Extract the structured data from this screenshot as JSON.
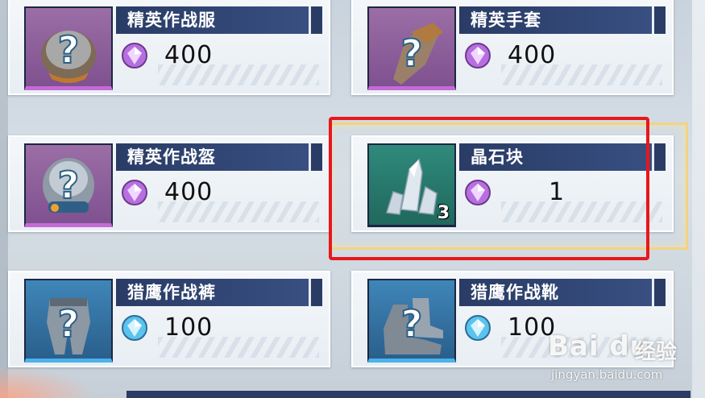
{
  "shop": {
    "items": [
      {
        "name": "精英作战服",
        "price": "400",
        "currency": "purple-gem",
        "rarity_color": "#9b6ea6"
      },
      {
        "name": "精英手套",
        "price": "400",
        "currency": "purple-gem",
        "rarity_color": "#9b6ea6"
      },
      {
        "name": "精英作战盔",
        "price": "400",
        "currency": "purple-gem",
        "rarity_color": "#9b6ea6"
      },
      {
        "name": "晶石块",
        "price": "1",
        "currency": "purple-gem",
        "stack": "3",
        "rarity_color": "#2f8a7c",
        "selected": true
      },
      {
        "name": "猎鹰作战裤",
        "price": "100",
        "currency": "blue-gem",
        "rarity_color": "#3f86b8"
      },
      {
        "name": "猎鹰作战靴",
        "price": "100",
        "currency": "blue-gem",
        "rarity_color": "#3f86b8"
      }
    ]
  },
  "watermark": {
    "logo": "Bai du",
    "cn": "经验",
    "url": "jingyan.baidu.com"
  },
  "colors": {
    "title_bar": "#2a3c66",
    "selection_rect": "#e8171b",
    "highlight_frame": "#f6d278"
  }
}
